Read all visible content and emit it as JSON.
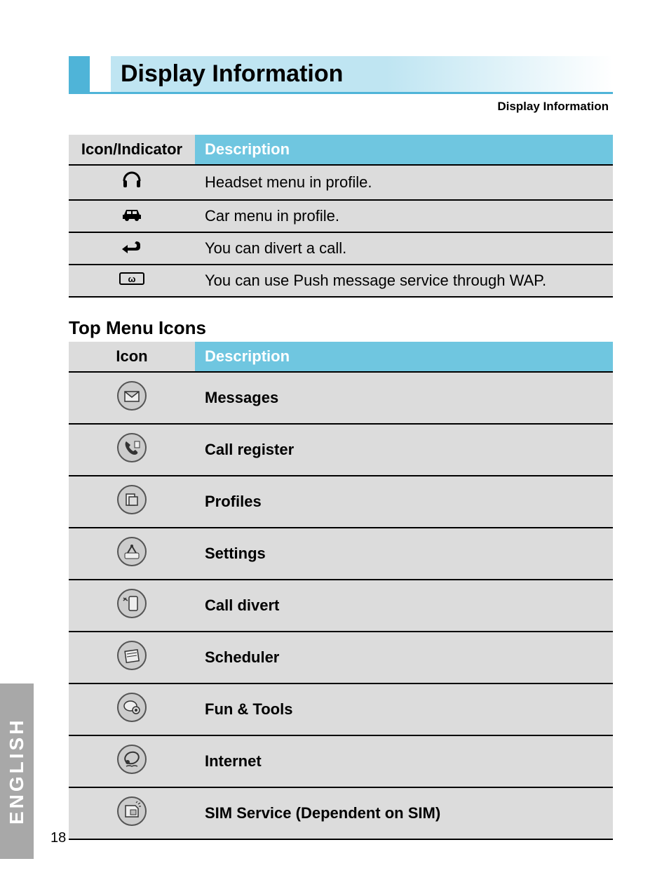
{
  "title": "Display Information",
  "breadcrumb": "Display Information",
  "indicator_table": {
    "header_icon": "Icon/Indicator",
    "header_desc": "Description",
    "rows": [
      {
        "icon": "headset-icon",
        "desc": "Headset menu in profile."
      },
      {
        "icon": "car-icon",
        "desc": "Car menu in profile."
      },
      {
        "icon": "divert-icon",
        "desc": "You can divert a call."
      },
      {
        "icon": "wap-push-icon",
        "desc": "You can use Push message service through WAP."
      }
    ]
  },
  "top_menu_heading": "Top Menu Icons",
  "menu_table": {
    "header_icon": "Icon",
    "header_desc": "Description",
    "rows": [
      {
        "icon": "messages-icon",
        "desc": "Messages"
      },
      {
        "icon": "call-register-icon",
        "desc": "Call register"
      },
      {
        "icon": "profiles-icon",
        "desc": "Profiles"
      },
      {
        "icon": "settings-icon",
        "desc": "Settings"
      },
      {
        "icon": "call-divert-icon",
        "desc": "Call divert"
      },
      {
        "icon": "scheduler-icon",
        "desc": "Scheduler"
      },
      {
        "icon": "fun-tools-icon",
        "desc": "Fun & Tools"
      },
      {
        "icon": "internet-icon",
        "desc": "Internet"
      },
      {
        "icon": "sim-service-icon",
        "desc": "SIM Service (Dependent on SIM)"
      }
    ]
  },
  "side_tab": "ENGLISH",
  "page_number": "18"
}
